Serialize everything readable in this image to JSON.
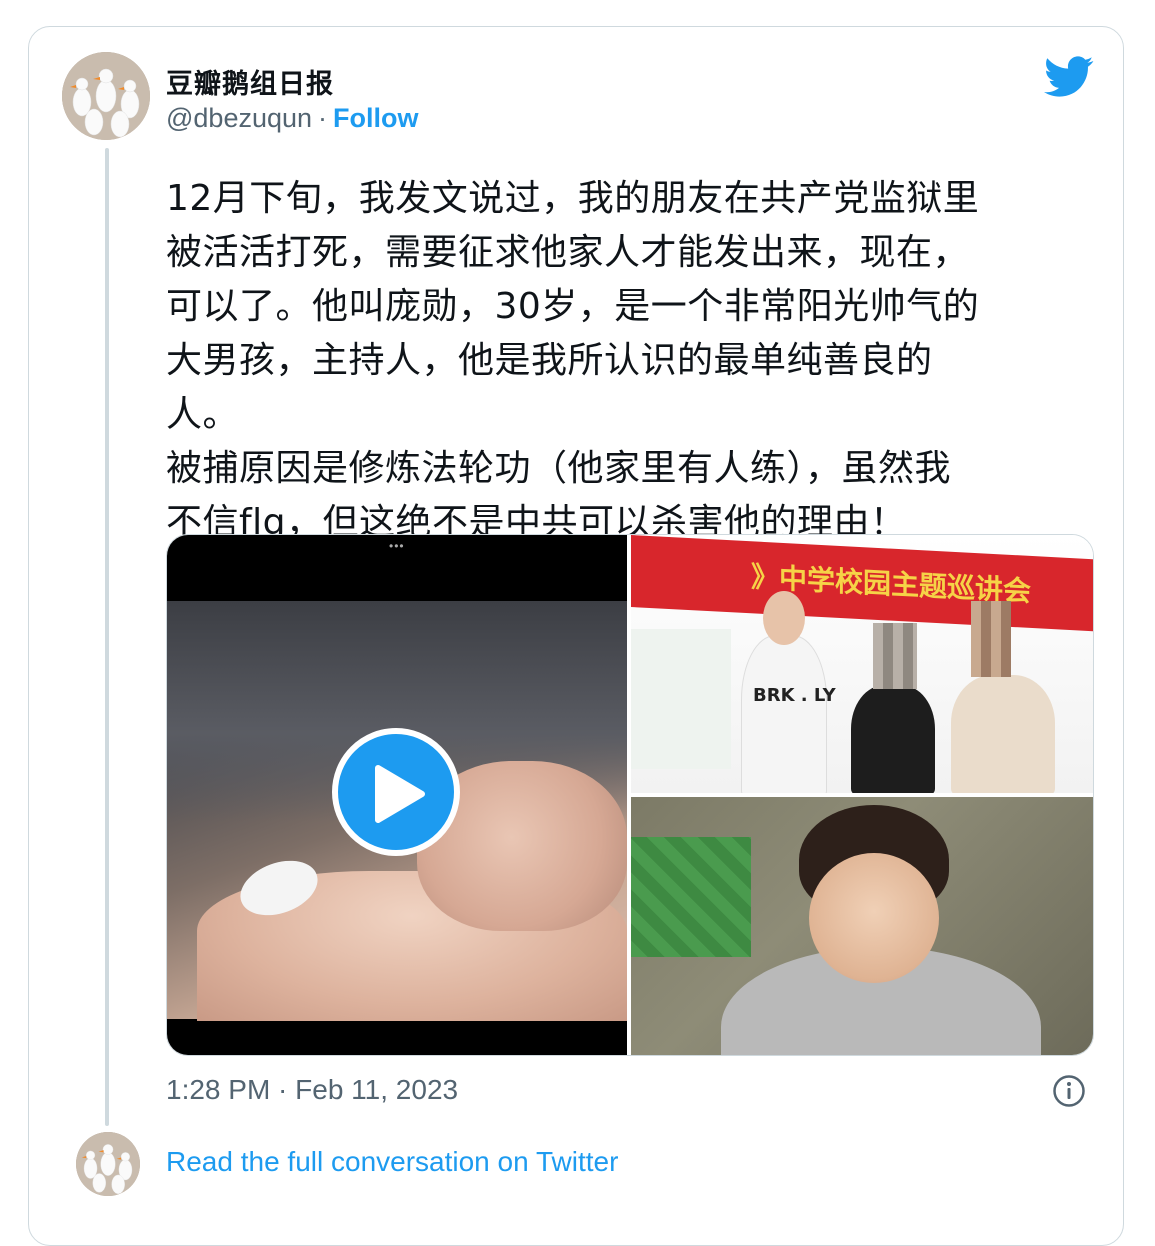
{
  "author": {
    "name": "豆瓣鹅组日报",
    "handle": "@dbezuqun",
    "separator": "·",
    "follow_label": "Follow",
    "avatar_icon": "goose-flock-avatar"
  },
  "brand": {
    "icon": "twitter-bird-icon",
    "color": "#1d9bf0"
  },
  "tweet": {
    "lines": [
      "12月下旬，我发文说过，我的朋友在共产党监狱里",
      "被活活打死，需要征求他家人才能发出来，现在，",
      "可以了。他叫庞勋，30岁，是一个非常阳光帅气的",
      "大男孩，主持人，他是我所认识的最单纯善良的",
      "人。",
      "被捕原因是修炼法轮功（他家里有人练），虽然我",
      "不信flg，但这绝不是中共可以杀害他的理由！"
    ]
  },
  "media": {
    "video": {
      "menu_glyph": "•••",
      "play_icon": "play-icon"
    },
    "photo_top": {
      "banner_text": "》中学校园主题巡讲会",
      "shirt_text": "BRK . LY"
    }
  },
  "meta": {
    "timestamp": "1:28 PM · Feb 11, 2023",
    "info_icon": "info-icon"
  },
  "footer": {
    "read_link": "Read the full conversation on Twitter"
  }
}
